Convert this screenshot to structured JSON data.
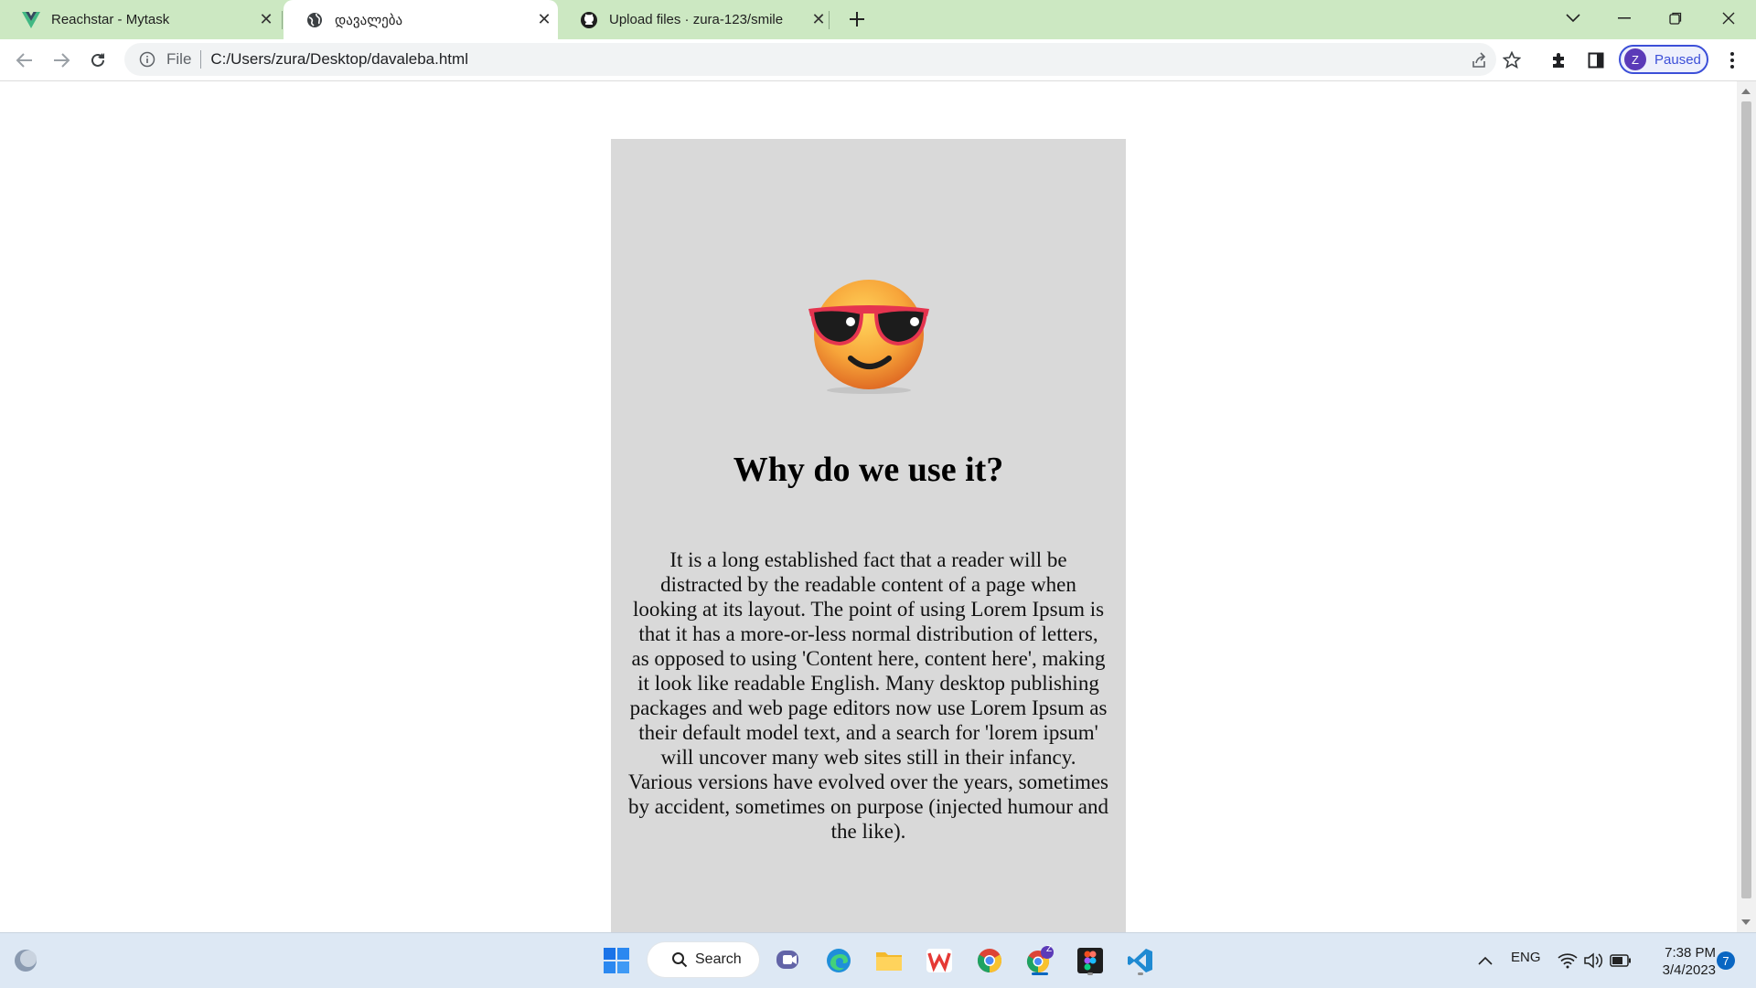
{
  "tabs": [
    {
      "title": "Reachstar - Mytask",
      "icon": "vue-logo-icon",
      "active": false
    },
    {
      "title": "დავალება",
      "icon": "globe-icon",
      "active": true
    },
    {
      "title": "Upload files · zura-123/smile",
      "icon": "github-icon",
      "active": false
    }
  ],
  "toolbar": {
    "scheme_label": "File",
    "url": "C:/Users/zura/Desktop/davaleba.html",
    "profile_initial": "Z",
    "profile_status": "Paused"
  },
  "page": {
    "emoji": "smiling-face-with-sunglasses",
    "heading": "Why do we use it?",
    "paragraph": "It is a long established fact that a reader will be distracted by the readable content of a page when looking at its layout. The point of using Lorem Ipsum is that it has a more-or-less normal distribution of letters, as opposed to using 'Content here, content here', making it look like readable English. Many desktop publishing packages and web page editors now use Lorem Ipsum as their default model text, and a search for 'lorem ipsum' will uncover many web sites still in their infancy. Various versions have evolved over the years, sometimes by accident, sometimes on purpose (injected humour and the like)."
  },
  "taskbar": {
    "search_label": "Search",
    "language": "ENG",
    "time": "7:38 PM",
    "date": "3/4/2023",
    "notification_count": "7",
    "chrome_profile_badge": "Z"
  },
  "colors": {
    "tabstrip": "#cce8c2",
    "card_bg": "#d9d9d9",
    "accent": "#3c4fd8"
  }
}
